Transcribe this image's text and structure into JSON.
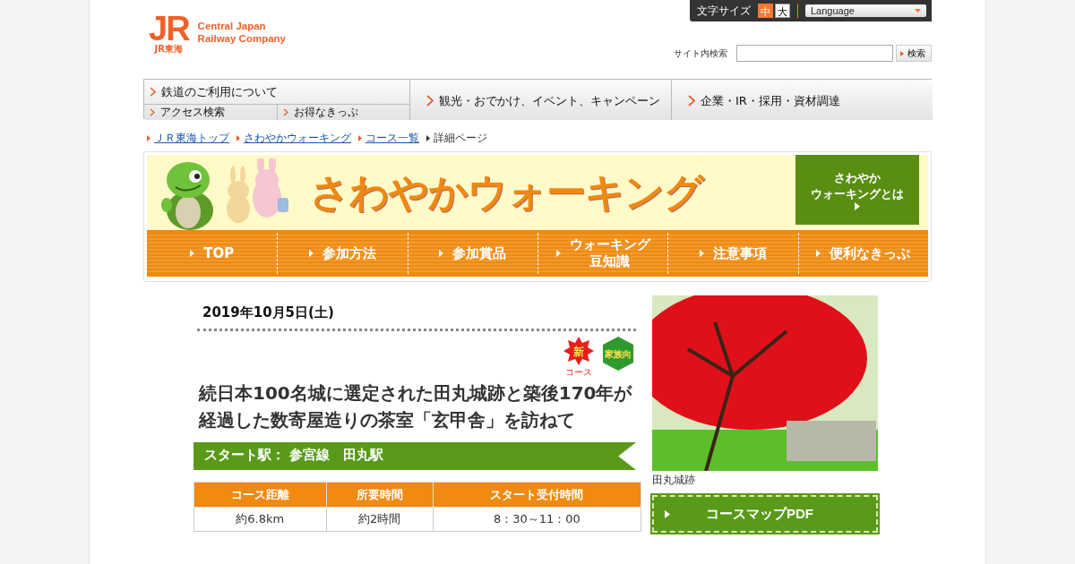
{
  "header": {
    "logo": {
      "mark": "JR",
      "sub": "JR東海",
      "name_lines": [
        "Central Japan",
        "Railway Company"
      ]
    },
    "font_size": {
      "label": "文字サイズ",
      "options": [
        {
          "label": "中",
          "selected": true
        },
        {
          "label": "大",
          "selected": false
        }
      ]
    },
    "language": "Language",
    "search": {
      "label": "サイト内検索",
      "button": "検索"
    }
  },
  "global_nav": [
    {
      "label": "鉄道のご利用について",
      "children": [
        {
          "label": "アクセス検索"
        },
        {
          "label": "お得なきっぷ"
        }
      ]
    },
    {
      "label": "観光・おでかけ、イベント、キャンペーン"
    },
    {
      "label": "企業・IR・採用・資材調達"
    }
  ],
  "breadcrumb": [
    {
      "label": "ＪＲ東海トップ",
      "kind": "link"
    },
    {
      "label": "さわやかウォーキング",
      "kind": "link"
    },
    {
      "label": "コース一覧",
      "kind": "link"
    },
    {
      "label": "詳細ページ",
      "kind": "current"
    }
  ],
  "banner": {
    "title": "さわやかウォーキング",
    "about_lines": [
      "さわやか",
      "ウォーキングとは"
    ],
    "nav": [
      {
        "lines": [
          "TOP"
        ]
      },
      {
        "lines": [
          "参加方法"
        ]
      },
      {
        "lines": [
          "参加賞品"
        ]
      },
      {
        "lines": [
          "ウォーキング",
          "豆知識"
        ]
      },
      {
        "lines": [
          "注意事項"
        ]
      },
      {
        "lines": [
          "便利なきっぷ"
        ]
      }
    ]
  },
  "detail": {
    "date": "2019年10月5日(土)",
    "badges": [
      {
        "kind": "new",
        "label": "新",
        "sub": "コース"
      },
      {
        "kind": "family",
        "label": "家族向"
      }
    ],
    "title": "続日本100名城に選定された田丸城跡と築後170年が経過した数寄屋造りの茶室「玄甲舎」を訪ねて",
    "start": "スタート駅：  参宮線　田丸駅",
    "table": {
      "columns": [
        "コース距離",
        "所要時間",
        "スタート受付時間"
      ],
      "rows": [
        [
          "約6.8km",
          "約2時間",
          "8：30～11：00"
        ]
      ]
    },
    "photo_caption": "田丸城跡",
    "map_button": "コースマップPDF"
  }
}
